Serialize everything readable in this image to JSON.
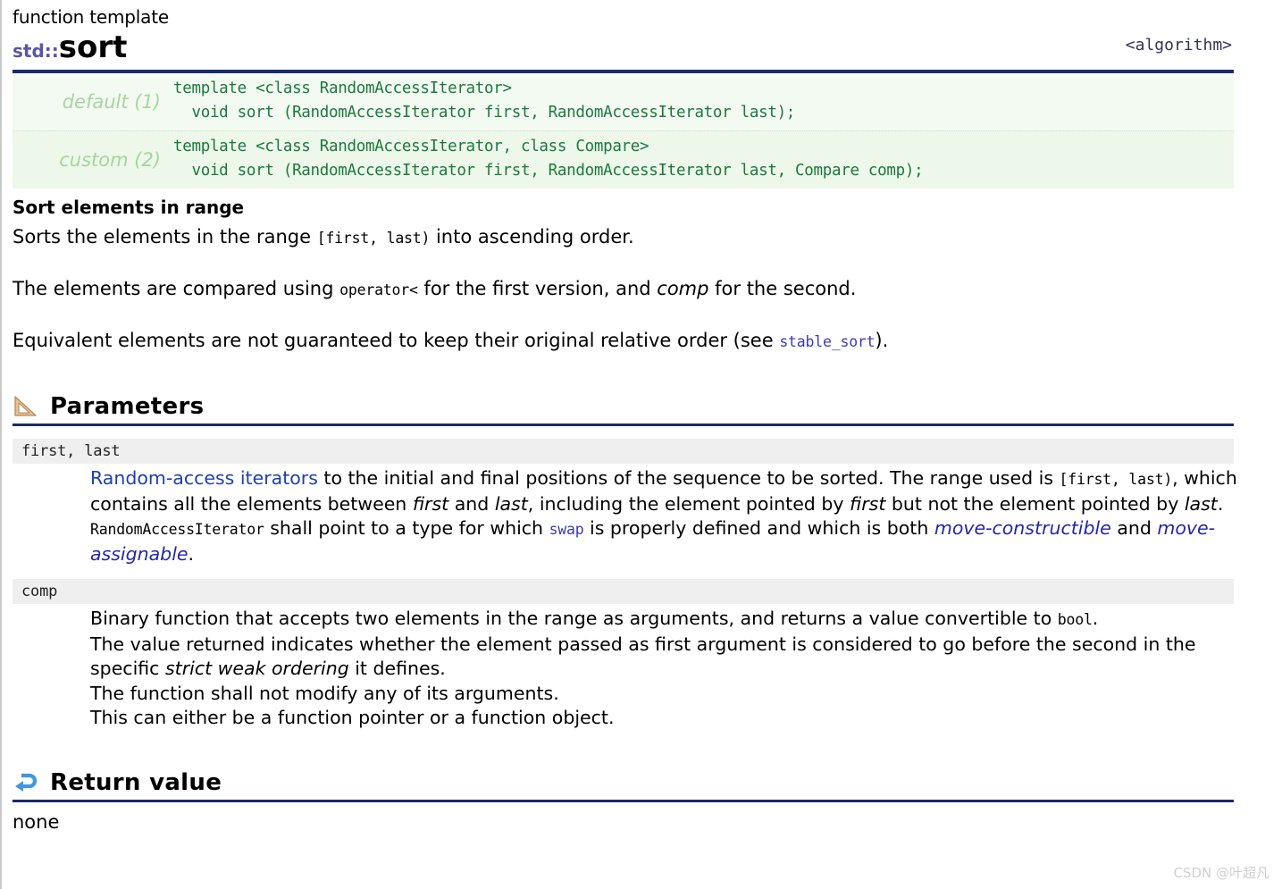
{
  "header": {
    "kind": "function template",
    "namespace": "std::",
    "name": "sort",
    "include": "<algorithm>"
  },
  "prototypes": [
    {
      "label": "default (1)",
      "code": "template <class RandomAccessIterator>\n  void sort (RandomAccessIterator first, RandomAccessIterator last);"
    },
    {
      "label": "custom (2)",
      "code": "template <class RandomAccessIterator, class Compare>\n  void sort (RandomAccessIterator first, RandomAccessIterator last, Compare comp);"
    }
  ],
  "description": {
    "subhead": "Sort elements in range",
    "p1": {
      "a": "Sorts the elements in the range ",
      "range": "[first, last)",
      "b": " into ascending order."
    },
    "p2": {
      "a": "The elements are compared using ",
      "op": "operator<",
      "b": " for the first version, and ",
      "comp": "comp",
      "c": " for the second."
    },
    "p3": {
      "a": "Equivalent elements are not guaranteed to keep their original relative order (see ",
      "link": "stable_sort",
      "b": ")."
    }
  },
  "sections": {
    "parameters": {
      "icon": "set-square-ruler-icon",
      "title": "Parameters",
      "items": [
        {
          "name": "first, last",
          "lines": [
            {
              "parts": [
                {
                  "t": "link",
                  "v": "Random-access iterators"
                },
                {
                  "t": "text",
                  "v": " to the initial and final positions of the sequence to be sorted. The range used is "
                },
                {
                  "t": "code",
                  "v": "[first, last)"
                },
                {
                  "t": "text",
                  "v": ", which contains all the elements between "
                },
                {
                  "t": "em",
                  "v": "first"
                },
                {
                  "t": "text",
                  "v": " and "
                },
                {
                  "t": "em",
                  "v": "last"
                },
                {
                  "t": "text",
                  "v": ", including the element pointed by "
                },
                {
                  "t": "em",
                  "v": "first"
                },
                {
                  "t": "text",
                  "v": " but not the element pointed by "
                },
                {
                  "t": "em",
                  "v": "last"
                },
                {
                  "t": "text",
                  "v": "."
                }
              ]
            },
            {
              "parts": [
                {
                  "t": "code",
                  "v": "RandomAccessIterator"
                },
                {
                  "t": "text",
                  "v": " shall point to a type for which "
                },
                {
                  "t": "codelink",
                  "v": "swap"
                },
                {
                  "t": "text",
                  "v": " is properly defined and which is both "
                },
                {
                  "t": "emlink",
                  "v": "move-constructible"
                },
                {
                  "t": "text",
                  "v": " and "
                },
                {
                  "t": "emlink",
                  "v": "move-assignable"
                },
                {
                  "t": "text",
                  "v": "."
                }
              ]
            }
          ]
        },
        {
          "name": "comp",
          "lines": [
            {
              "parts": [
                {
                  "t": "text",
                  "v": "Binary function that accepts two elements in the range as arguments, and returns a value convertible to "
                },
                {
                  "t": "code",
                  "v": "bool"
                },
                {
                  "t": "text",
                  "v": "."
                }
              ]
            },
            {
              "parts": [
                {
                  "t": "text",
                  "v": "The value returned indicates whether the element passed as first argument is considered to go before the second in the specific "
                },
                {
                  "t": "em",
                  "v": "strict weak ordering"
                },
                {
                  "t": "text",
                  "v": " it defines."
                }
              ]
            },
            {
              "parts": [
                {
                  "t": "text",
                  "v": "The function shall not modify any of its arguments."
                }
              ]
            },
            {
              "parts": [
                {
                  "t": "text",
                  "v": "This can either be a function pointer or a function object."
                }
              ]
            }
          ]
        }
      ]
    },
    "return_value": {
      "icon": "return-arrow-icon",
      "title": "Return value",
      "text": "none"
    }
  },
  "watermark": "CSDN @叶超凡",
  "colors": {
    "rule": "#1b2a6b",
    "namespace": "#5757a6",
    "code_green": "#1a7a3c",
    "sig_bg": "#f3faf1",
    "sig_label": "#a8d5a0",
    "link": "#1f3fb0",
    "param_band": "#efefef",
    "watermark": "#cfcfcf"
  }
}
